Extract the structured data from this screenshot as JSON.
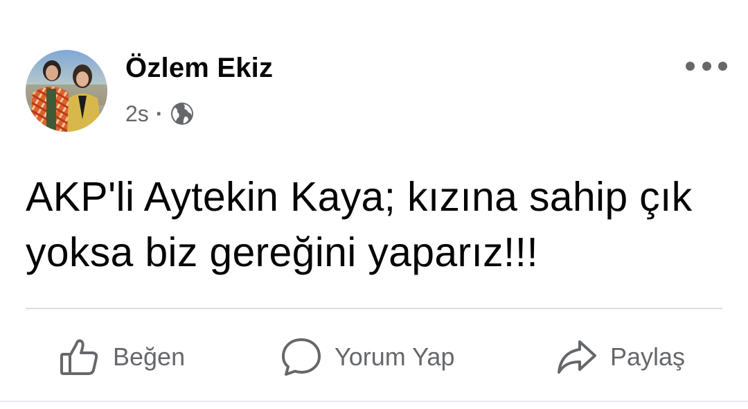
{
  "post": {
    "author": "Özlem Ekiz",
    "time": "2s",
    "separator": "·",
    "privacy_icon": "globe-icon",
    "more_icon": "more-options-icon",
    "text": "AKP'li Aytekin Kaya; kızına sahip çık yoksa biz gereğini yaparız!!!"
  },
  "actions": {
    "like": {
      "label": "Beğen",
      "icon": "thumbs-up-icon"
    },
    "comment": {
      "label": "Yorum Yap",
      "icon": "comment-bubble-icon"
    },
    "share": {
      "label": "Paylaş",
      "icon": "share-arrow-icon"
    }
  },
  "colors": {
    "text_primary": "#050505",
    "text_secondary": "#65676b",
    "divider": "#dadde1",
    "background": "#ffffff"
  }
}
